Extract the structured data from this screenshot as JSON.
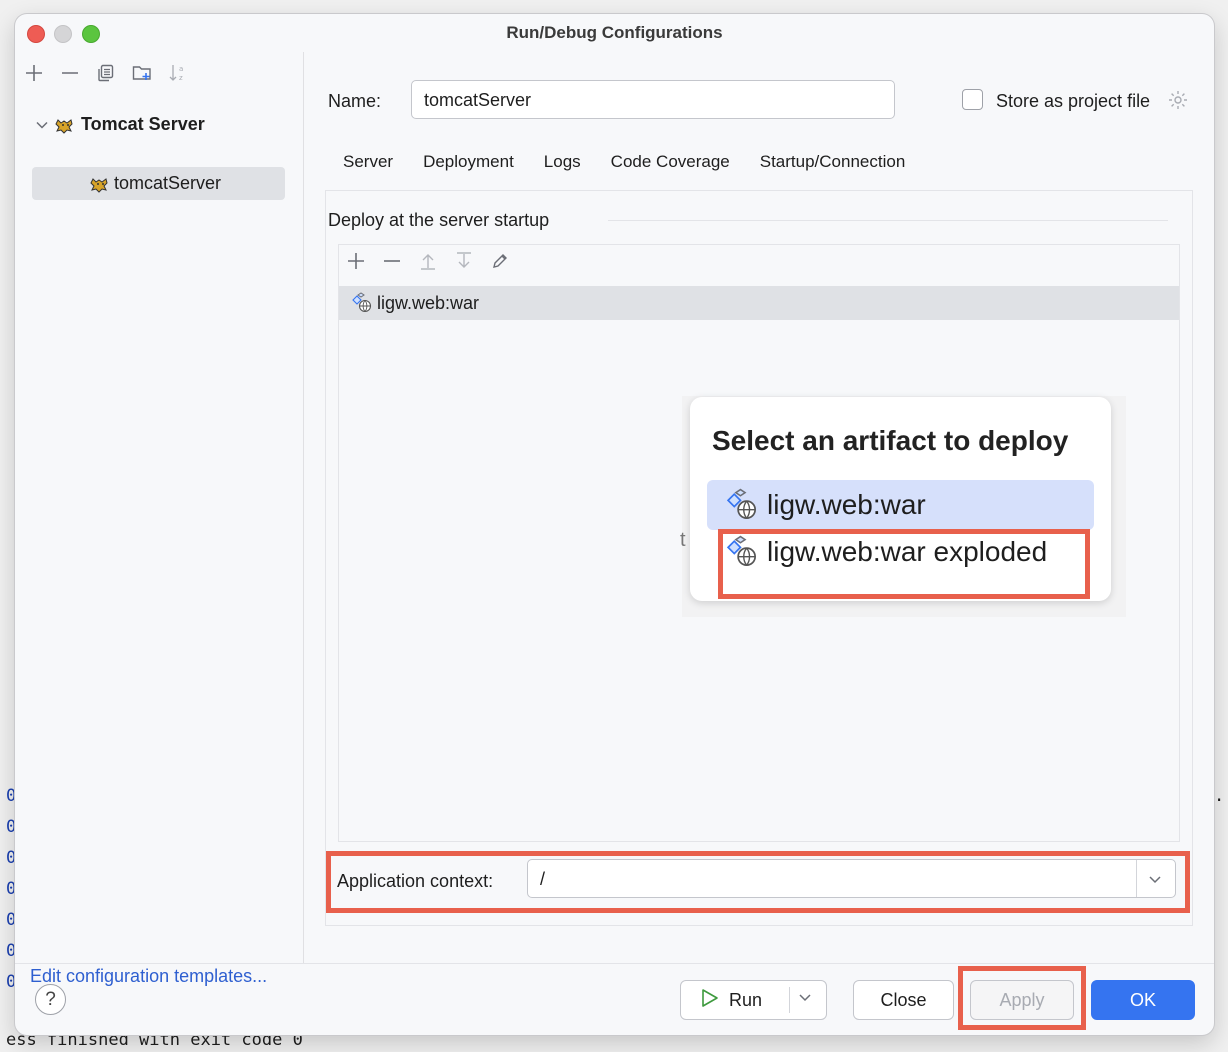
{
  "window": {
    "title": "Run/Debug Configurations"
  },
  "sidebar": {
    "toolbar_icons": [
      "add-icon",
      "remove-icon",
      "copy-icon",
      "new-folder-icon",
      "sort-icon"
    ],
    "group_label": "Tomcat Server",
    "selected_item": "tomcatServer",
    "edit_templates_link": "Edit configuration templates..."
  },
  "form": {
    "name_label": "Name:",
    "name_value": "tomcatServer",
    "store_label": "Store as project file",
    "store_checked": false
  },
  "tabs": [
    {
      "label": "Server",
      "active": false
    },
    {
      "label": "Deployment",
      "active": true
    },
    {
      "label": "Logs",
      "active": false
    },
    {
      "label": "Code Coverage",
      "active": false
    },
    {
      "label": "Startup/Connection",
      "active": false
    }
  ],
  "deployment": {
    "section_title": "Deploy at the server startup",
    "items": [
      "ligw.web:war"
    ],
    "app_context_label": "Application context:",
    "app_context_value": "/"
  },
  "artifact_popup": {
    "title": "Select an artifact to deploy",
    "options": [
      "ligw.web:war",
      "ligw.web:war exploded"
    ],
    "selected_index": 0
  },
  "footer": {
    "help": "?",
    "run_label": "Run",
    "close_label": "Close",
    "apply_label": "Apply",
    "ok_label": "OK"
  },
  "console": {
    "left_fragments": [
      "0",
      "0",
      "0",
      "0",
      "0",
      "0",
      "0"
    ],
    "right_fragment": ".:",
    "bottom_text": "ess finished with exit code 0"
  },
  "colors": {
    "accent": "#3574f0",
    "highlight": "#e8604c",
    "link": "#2e5fd0"
  }
}
